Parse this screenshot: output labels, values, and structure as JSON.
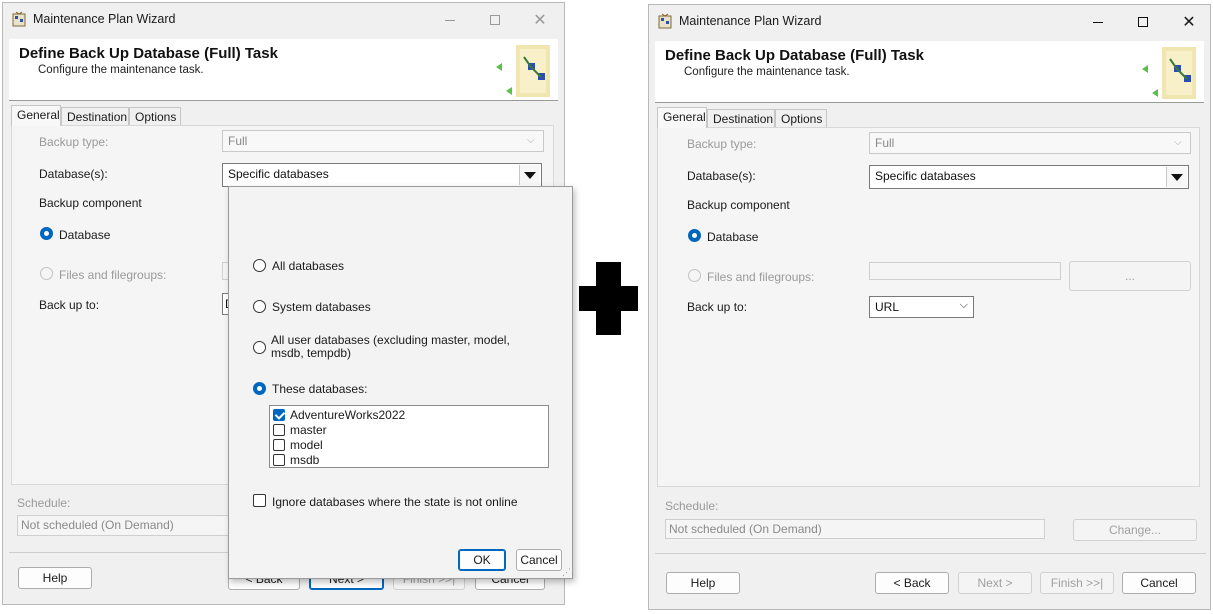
{
  "window_title": "Maintenance Plan Wizard",
  "header": {
    "title": "Define Back Up Database (Full) Task",
    "subtitle": "Configure the maintenance task."
  },
  "tabs": [
    "General",
    "Destination",
    "Options"
  ],
  "form": {
    "backup_type_label": "Backup type:",
    "backup_type_value": "Full",
    "databases_label": "Database(s):",
    "databases_value": "Specific databases",
    "backup_component_label": "Backup component",
    "database_option": "Database",
    "files_option": "Files and filegroups:",
    "files_button": "...",
    "backup_to_label": "Back up to:",
    "backup_to_value": "URL"
  },
  "schedule": {
    "label": "Schedule:",
    "value": "Not scheduled (On Demand)",
    "change_button": "Change..."
  },
  "footer": {
    "help": "Help",
    "back": "< Back",
    "next": "Next >",
    "finish": "Finish >>|",
    "cancel": "Cancel"
  },
  "popup": {
    "options": {
      "all": "All databases",
      "system": "System databases",
      "all_user": "All user databases  (excluding master, model, msdb, tempdb)",
      "these": "These databases:"
    },
    "databases": [
      {
        "name": "AdventureWorks2022",
        "checked": true
      },
      {
        "name": "master",
        "checked": false
      },
      {
        "name": "model",
        "checked": false
      },
      {
        "name": "msdb",
        "checked": false
      }
    ],
    "ignore_offline": "Ignore databases where the state is not online",
    "ok": "OK",
    "cancel": "Cancel"
  },
  "left_partial": {
    "back_to_fragment": "D",
    "back": "< Back",
    "next": "Next >",
    "finish": "Finish >>|",
    "cancel": "Cancel"
  },
  "colors": {
    "accent": "#0067c0",
    "window_bg": "#f0f0f0",
    "disabled_text": "#9a9a9a"
  }
}
